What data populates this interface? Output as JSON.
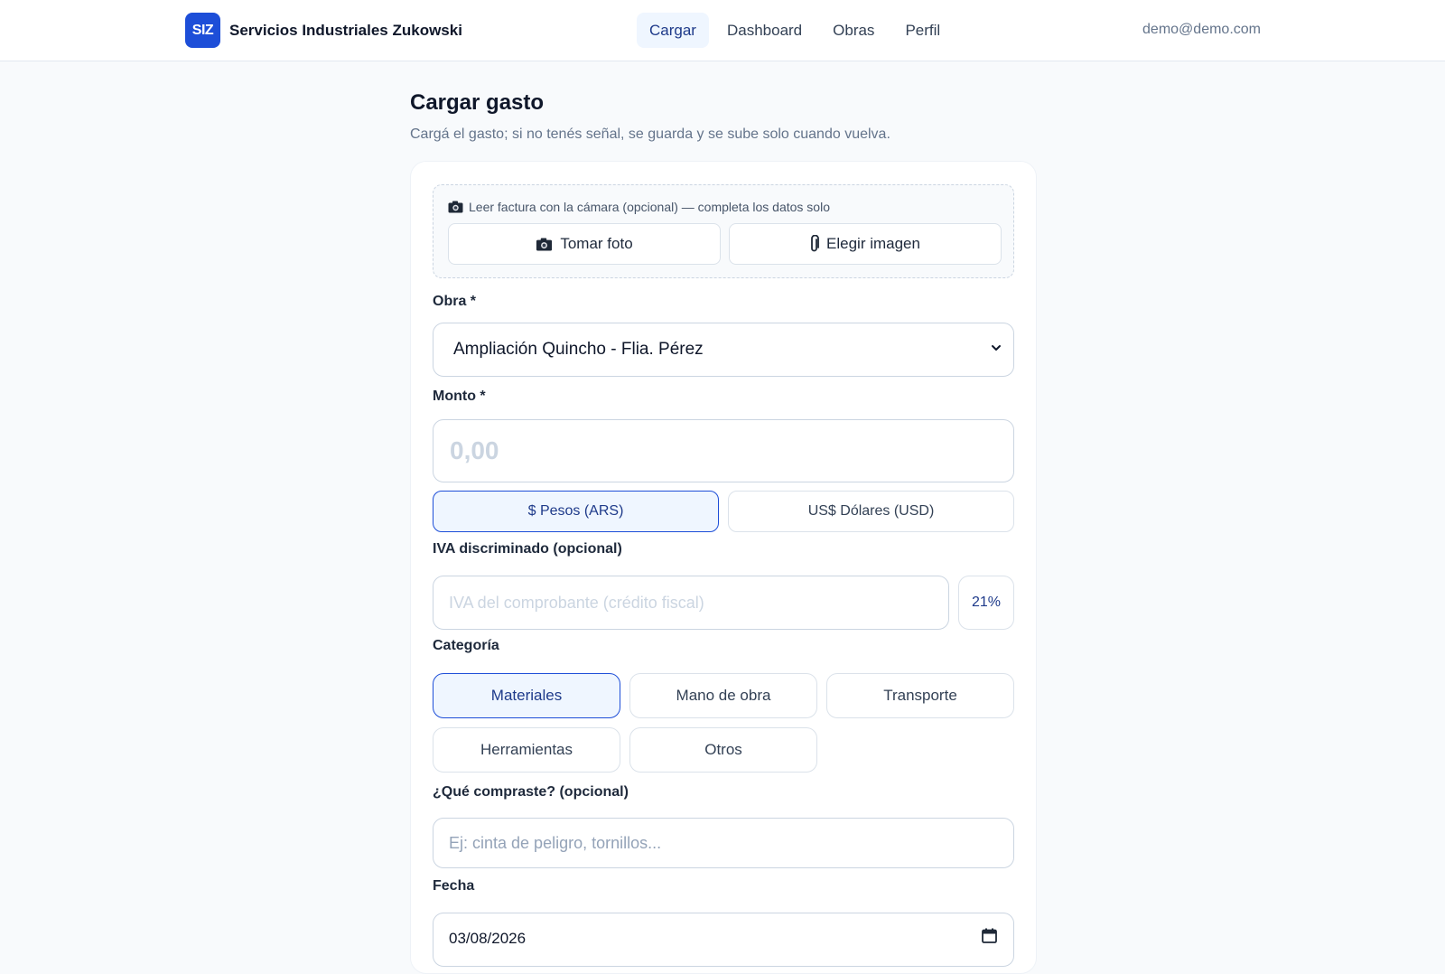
{
  "header": {
    "logo_text": "SIZ",
    "company_name": "Servicios Industriales Zukowski",
    "nav": [
      {
        "label": "Cargar",
        "active": true
      },
      {
        "label": "Dashboard",
        "active": false
      },
      {
        "label": "Obras",
        "active": false
      },
      {
        "label": "Perfil",
        "active": false
      }
    ],
    "user_email": "demo@demo.com"
  },
  "page": {
    "title": "Cargar gasto",
    "subtitle": "Cargá el gasto; si no tenés señal, se guarda y se sube solo cuando vuelva."
  },
  "form": {
    "scan": {
      "hint": "Leer factura con la cámara (opcional) — completa los datos solo",
      "take_photo_label": "Tomar foto",
      "choose_image_label": "Elegir imagen"
    },
    "obra": {
      "label": "Obra *",
      "selected": "Ampliación Quincho - Flia. Pérez"
    },
    "monto": {
      "label": "Monto *",
      "placeholder": "0,00",
      "currency_ars": "$ Pesos (ARS)",
      "currency_usd": "US$ Dólares (USD)",
      "selected_currency": "ARS"
    },
    "iva": {
      "label": "IVA discriminado (opcional)",
      "placeholder": "IVA del comprobante (crédito fiscal)",
      "rate_button": "21%"
    },
    "categoria": {
      "label": "Categoría",
      "options": [
        "Materiales",
        "Mano de obra",
        "Transporte",
        "Herramientas",
        "Otros"
      ],
      "selected": "Materiales"
    },
    "descripcion": {
      "label": "¿Qué compraste? (opcional)",
      "placeholder": "Ej: cinta de peligro, tornillos..."
    },
    "fecha": {
      "label": "Fecha",
      "value": "03/08/2026"
    }
  },
  "colors": {
    "brand": "#1d4ed8",
    "active_bg": "#eff6ff",
    "active_text": "#1e3a8a",
    "page_bg": "#f8fafc"
  }
}
